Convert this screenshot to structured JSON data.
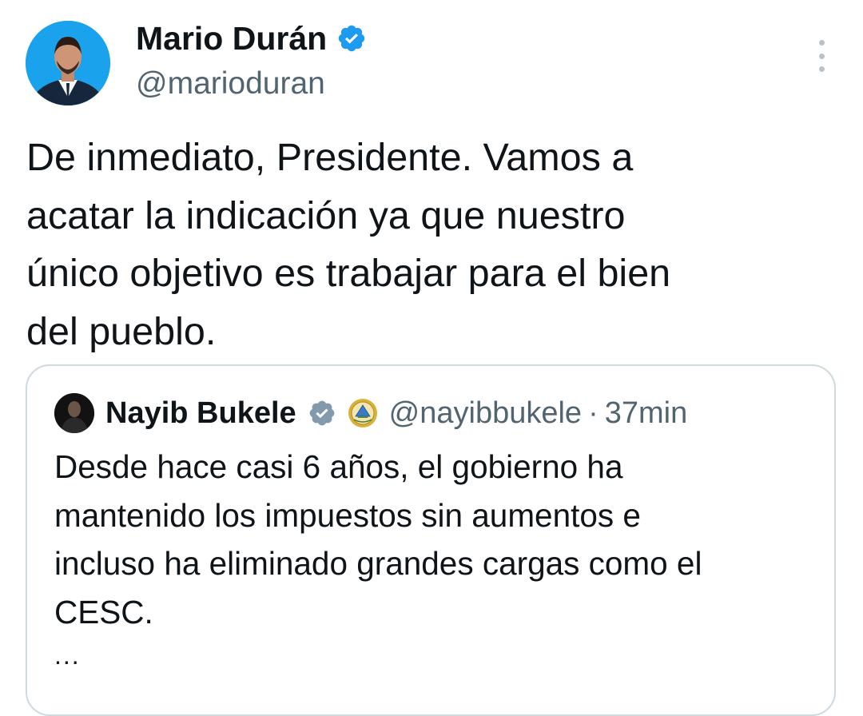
{
  "author": {
    "name": "Mario Durán",
    "handle": "@marioduran",
    "verified": true
  },
  "tweet": {
    "lines": [
      "De inmediato, Presidente. Vamos a",
      "acatar la indicación ya que nuestro",
      "único objetivo es trabajar para el bien",
      "del pueblo."
    ]
  },
  "quote": {
    "name": "Nayib Bukele",
    "handle": "@nayibbukele",
    "separator": "·",
    "time": "37min",
    "verified_badge": "gray-verified-badge-icon",
    "affiliation_badge": "government-seal-icon",
    "lines": [
      "Desde hace casi 6 años, el gobierno ha",
      "mantenido los impuestos sin aumentos e",
      "incluso ha eliminado grandes cargas como el",
      "CESC."
    ],
    "ellipsis": "..."
  },
  "colors": {
    "verified_blue": "#1d9bf0",
    "secondary_text": "#536471",
    "border": "#cfd9de",
    "text": "#0f1419"
  }
}
